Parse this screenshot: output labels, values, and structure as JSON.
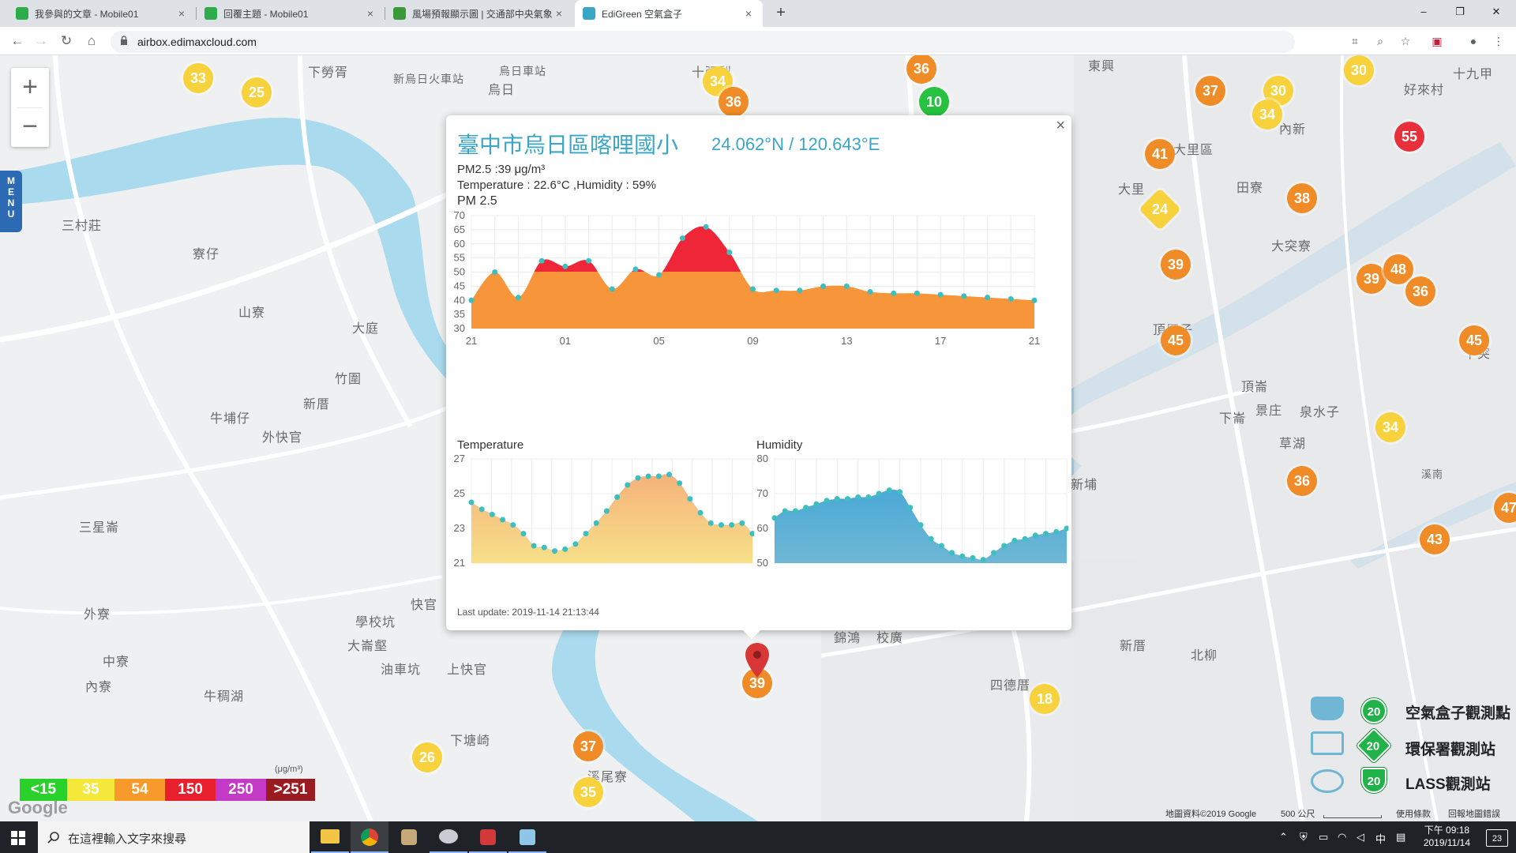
{
  "browser": {
    "tabs": [
      {
        "label": "我參與的文章 - Mobile01",
        "color": "#2eab4a"
      },
      {
        "label": "回覆主題 - Mobile01",
        "color": "#2eab4a"
      },
      {
        "label": "風場預報顯示圖 | 交通部中央氣象局",
        "color": "#3a9a3a"
      },
      {
        "label": "EdiGreen 空氣盒子",
        "color": "#3aa6c6"
      }
    ],
    "close_glyph": "×",
    "new_tab_glyph": "+",
    "url": "airbox.edimaxcloud.com",
    "icons": [
      "back-icon",
      "forward-icon",
      "reload-icon",
      "home-icon",
      "translate-icon",
      "zoom-icon",
      "bookmark-star-icon",
      "extension-icon",
      "profile-icon",
      "menu-dots-icon"
    ]
  },
  "map": {
    "zoom_in": "+",
    "zoom_out": "−",
    "menu_label": "MENU",
    "place_labels": [
      {
        "text": "下勞胥"
      },
      {
        "text": "新烏日火車站"
      },
      {
        "text": "烏日車站"
      },
      {
        "text": "烏日"
      },
      {
        "text": "三村莊"
      },
      {
        "text": "寮仔"
      },
      {
        "text": "山寮"
      },
      {
        "text": "大庭"
      },
      {
        "text": "竹圍"
      },
      {
        "text": "新厝"
      },
      {
        "text": "牛埔仔"
      },
      {
        "text": "外快官"
      },
      {
        "text": "三星崙"
      },
      {
        "text": "外寮"
      },
      {
        "text": "中寮"
      },
      {
        "text": "內寮"
      },
      {
        "text": "牛稠湖"
      },
      {
        "text": "學校坑"
      },
      {
        "text": "大崙壑"
      },
      {
        "text": "油車坑"
      },
      {
        "text": "上快官"
      },
      {
        "text": "快官"
      },
      {
        "text": "下塘崎"
      },
      {
        "text": "溪尾寮"
      },
      {
        "text": "大里區"
      },
      {
        "text": "大里"
      },
      {
        "text": "田寮"
      },
      {
        "text": "大突寮"
      },
      {
        "text": "頂厝子"
      },
      {
        "text": "頂崙"
      },
      {
        "text": "景庄"
      },
      {
        "text": "泉水子"
      },
      {
        "text": "下崙"
      },
      {
        "text": "草湖"
      },
      {
        "text": "新埔"
      },
      {
        "text": "新厝"
      },
      {
        "text": "北柳"
      },
      {
        "text": "四德厝"
      },
      {
        "text": "內新"
      },
      {
        "text": "好來村"
      },
      {
        "text": "十九甲"
      },
      {
        "text": "東興"
      },
      {
        "text": "錦鴻"
      },
      {
        "text": "校廣"
      },
      {
        "text": "十張犁"
      },
      {
        "text": "溪南"
      },
      {
        "text": "下突"
      }
    ],
    "markers": [
      {
        "v": "33",
        "c": "#f7d23c"
      },
      {
        "v": "25",
        "c": "#f7d23c"
      },
      {
        "v": "34",
        "c": "#f7d23c"
      },
      {
        "v": "36",
        "c": "#f08c28"
      },
      {
        "v": "36",
        "c": "#f08c28"
      },
      {
        "v": "10",
        "c": "#27c23f"
      },
      {
        "v": "37",
        "c": "#f08c28"
      },
      {
        "v": "30",
        "c": "#f7d23c"
      },
      {
        "v": "30",
        "c": "#f7d23c"
      },
      {
        "v": "34",
        "c": "#f7d23c"
      },
      {
        "v": "55",
        "c": "#e8303c"
      },
      {
        "v": "41",
        "c": "#f08c28"
      },
      {
        "v": "24",
        "c": "#f7d23c"
      },
      {
        "v": "38",
        "c": "#f08c28"
      },
      {
        "v": "39",
        "c": "#f08c28"
      },
      {
        "v": "39",
        "c": "#f08c28"
      },
      {
        "v": "48",
        "c": "#f08c28"
      },
      {
        "v": "36",
        "c": "#f08c28"
      },
      {
        "v": "45",
        "c": "#f08c28"
      },
      {
        "v": "45",
        "c": "#f08c28"
      },
      {
        "v": "34",
        "c": "#f7d23c"
      },
      {
        "v": "36",
        "c": "#f08c28"
      },
      {
        "v": "43",
        "c": "#f08c28"
      },
      {
        "v": "47",
        "c": "#f08c28"
      },
      {
        "v": "18",
        "c": "#f7d23c"
      },
      {
        "v": "39",
        "c": "#f08c28"
      },
      {
        "v": "37",
        "c": "#f08c28"
      },
      {
        "v": "26",
        "c": "#f7d23c"
      },
      {
        "v": "35",
        "c": "#f7d23c"
      }
    ]
  },
  "popup": {
    "close_glyph": "×",
    "title": "臺中市烏日區喀哩國小",
    "coords": "24.062°N / 120.643°E",
    "pm25_line": "PM2.5 :39 μg/m³",
    "temp_humidity_line": "Temperature : 22.6°C ,Humidity : 59%",
    "pm_chart_title": "PM 2.5",
    "temp_chart_title": "Temperature",
    "hum_chart_title": "Humidity",
    "last_update": "Last update: 2019-11-14 21:13:44"
  },
  "chart_data": [
    {
      "type": "area",
      "title": "PM 2.5",
      "x_ticks": [
        "21",
        "01",
        "05",
        "09",
        "13",
        "17",
        "21"
      ],
      "y_ticks": [
        "70",
        "65",
        "60",
        "55",
        "50",
        "45",
        "40",
        "35",
        "30"
      ],
      "ylim": [
        30,
        70
      ],
      "threshold": 50,
      "colors": {
        "below": "#f7953a",
        "above": "#ef2637",
        "point": "#3dbfc0"
      },
      "values": [
        40,
        50,
        41,
        54,
        52,
        54,
        44,
        51,
        49,
        62,
        66,
        57,
        44,
        43.5,
        43.5,
        45,
        45,
        43,
        42.5,
        42.5,
        42,
        41.5,
        41,
        40.5,
        40
      ]
    },
    {
      "type": "area",
      "title": "Temperature",
      "y_ticks": [
        "27",
        "25",
        "23",
        "21"
      ],
      "ylim": [
        21,
        27
      ],
      "colors": {
        "top": "#f5b27a",
        "bottom": "#f7e08a",
        "point": "#3dbfc0"
      },
      "values": [
        24.5,
        24.1,
        23.8,
        23.5,
        23.2,
        22.7,
        22.0,
        21.9,
        21.7,
        21.8,
        22.1,
        22.7,
        23.3,
        24.0,
        24.8,
        25.5,
        25.9,
        26.0,
        26.0,
        26.1,
        25.6,
        24.7,
        23.9,
        23.3,
        23.2,
        23.2,
        23.3,
        22.7
      ]
    },
    {
      "type": "area",
      "title": "Humidity",
      "y_ticks": [
        "80",
        "70",
        "60",
        "50"
      ],
      "ylim": [
        50,
        80
      ],
      "colors": {
        "top": "#4aa9d6",
        "bottom": "#6fb7d5",
        "point": "#3dbfc0"
      },
      "values": [
        63,
        65,
        65,
        66,
        67,
        68,
        68.5,
        68.5,
        69,
        69,
        70,
        71,
        70.5,
        66,
        61,
        57,
        55,
        53,
        52,
        51.5,
        51,
        53,
        55,
        56.5,
        57,
        58,
        58.5,
        59,
        60
      ]
    }
  ],
  "aq_legend": {
    "unit": "(μg/m³)",
    "items": [
      {
        "label": "<15",
        "color": "#2bd12b"
      },
      {
        "label": "35",
        "color": "#f6e83a"
      },
      {
        "label": "54",
        "color": "#f59a2b"
      },
      {
        "label": "150",
        "color": "#e8202d"
      },
      {
        "label": "250",
        "color": "#c43ac7"
      },
      {
        "label": ">251",
        "color": "#9b1b22"
      }
    ]
  },
  "station_legend": [
    {
      "badge": "20",
      "label": "空氣盒子觀測點"
    },
    {
      "badge": "20",
      "label": "環保署觀測站"
    },
    {
      "badge": "20",
      "label": "LASS觀測站"
    }
  ],
  "google_footer": {
    "map_data": "地圖資料©2019 Google",
    "scale": "500 公尺",
    "terms": "使用條款",
    "report": "回報地圖錯誤",
    "logo": "Google"
  },
  "taskbar": {
    "search_placeholder": "在這裡輸入文字來搜尋",
    "time": "下午 09:18",
    "date": "2019/11/14",
    "ime": "中",
    "notifications": "23"
  }
}
